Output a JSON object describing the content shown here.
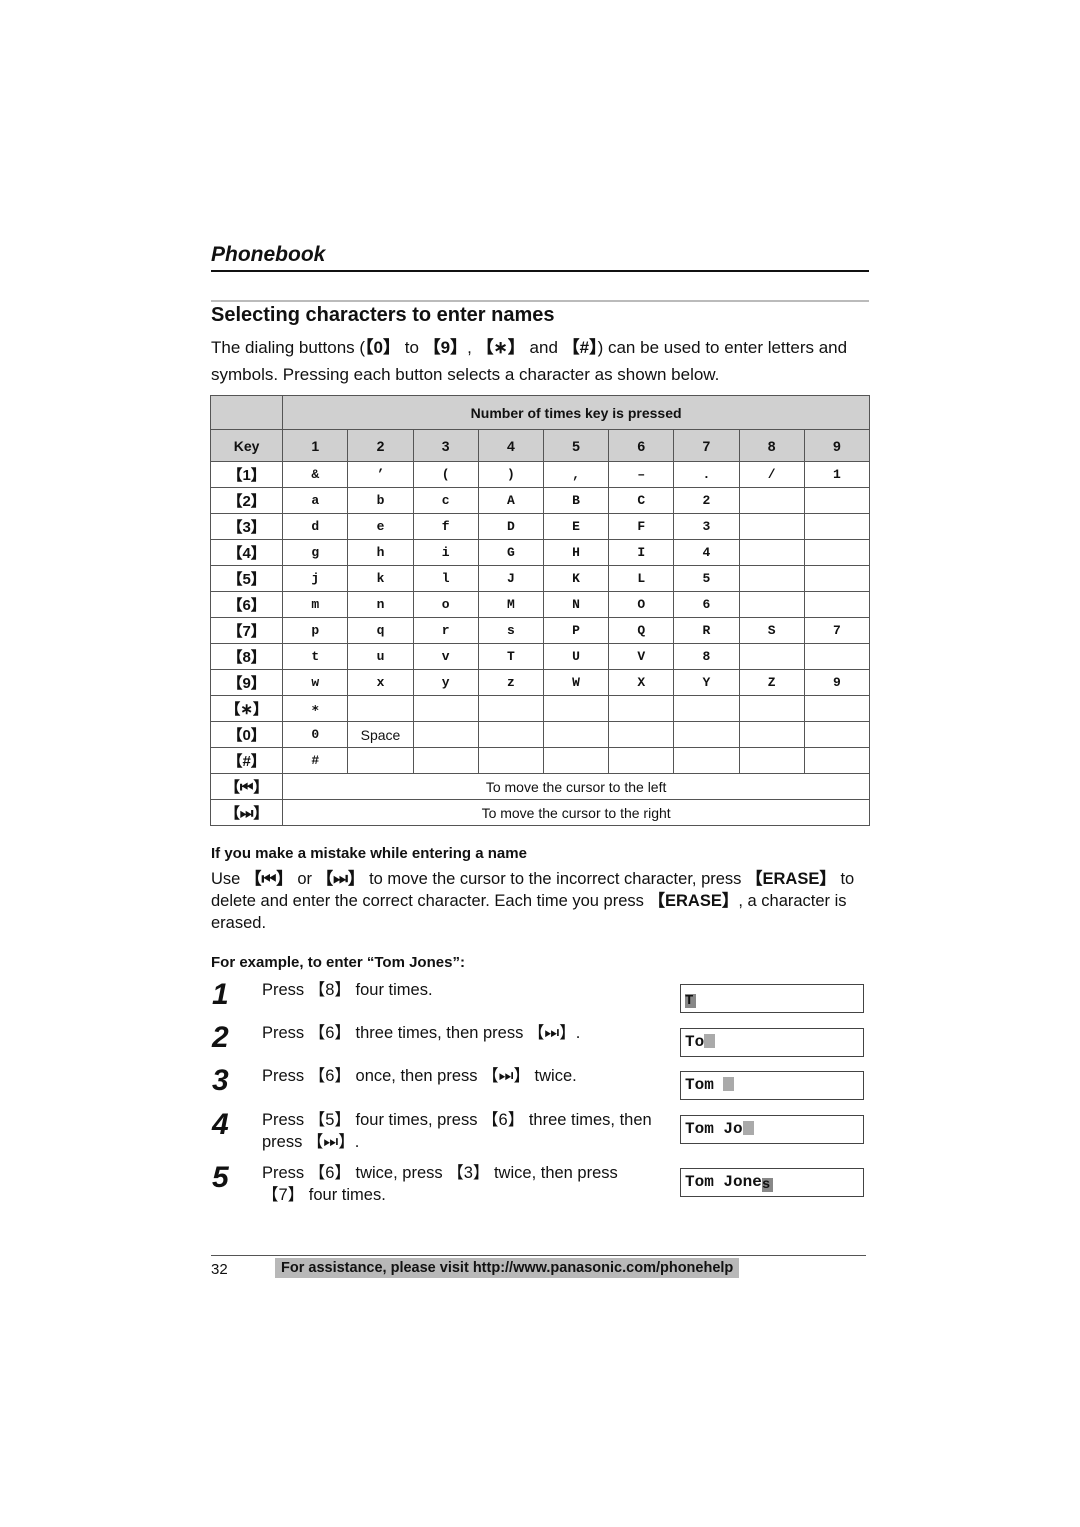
{
  "section": {
    "title": "Phonebook"
  },
  "heading": "Selecting characters to enter names",
  "intro": {
    "p1": "The dialing buttons (",
    "k0": "【0】",
    "p2": " to ",
    "k9": "【9】",
    "p3": ", ",
    "kstar": "【∗】",
    "p4": " and ",
    "khash": "【#】",
    "p5": ") can be used to enter letters and symbols. Pressing each button selects a character as shown below."
  },
  "table": {
    "group_header": "Number of times key is pressed",
    "key_header": "Key",
    "press_counts": [
      "1",
      "2",
      "3",
      "4",
      "5",
      "6",
      "7",
      "8",
      "9"
    ],
    "rows": [
      {
        "key": "【1】",
        "chars": [
          "&",
          "’",
          "(",
          ")",
          ",",
          "–",
          ".",
          "/",
          "1"
        ]
      },
      {
        "key": "【2】",
        "chars": [
          "a",
          "b",
          "c",
          "A",
          "B",
          "C",
          "2",
          "",
          ""
        ]
      },
      {
        "key": "【3】",
        "chars": [
          "d",
          "e",
          "f",
          "D",
          "E",
          "F",
          "3",
          "",
          ""
        ]
      },
      {
        "key": "【4】",
        "chars": [
          "g",
          "h",
          "i",
          "G",
          "H",
          "I",
          "4",
          "",
          ""
        ]
      },
      {
        "key": "【5】",
        "chars": [
          "j",
          "k",
          "l",
          "J",
          "K",
          "L",
          "5",
          "",
          ""
        ]
      },
      {
        "key": "【6】",
        "chars": [
          "m",
          "n",
          "o",
          "M",
          "N",
          "O",
          "6",
          "",
          ""
        ]
      },
      {
        "key": "【7】",
        "chars": [
          "p",
          "q",
          "r",
          "s",
          "P",
          "Q",
          "R",
          "S",
          "7"
        ]
      },
      {
        "key": "【8】",
        "chars": [
          "t",
          "u",
          "v",
          "T",
          "U",
          "V",
          "8",
          "",
          ""
        ]
      },
      {
        "key": "【9】",
        "chars": [
          "w",
          "x",
          "y",
          "z",
          "W",
          "X",
          "Y",
          "Z",
          "9"
        ]
      },
      {
        "key": "【∗】",
        "chars": [
          "∗",
          "",
          "",
          "",
          "",
          "",
          "",
          "",
          ""
        ]
      },
      {
        "key": "【0】",
        "chars": [
          "0",
          "Space",
          "",
          "",
          "",
          "",
          "",
          "",
          ""
        ]
      },
      {
        "key": "【#】",
        "chars": [
          "#",
          "",
          "",
          "",
          "",
          "",
          "",
          "",
          ""
        ]
      }
    ],
    "nav_rows": [
      {
        "key": "【⏮】",
        "icon": "skip-back-icon",
        "text": "To move the cursor to the left"
      },
      {
        "key": "【⏭】",
        "icon": "skip-forward-icon",
        "text": "To move the cursor to the right"
      }
    ]
  },
  "mistake": {
    "title": "If you make a mistake while entering a name",
    "p1": "Use ",
    "k_left": "【⏮】",
    "p2": " or ",
    "k_right": "【⏭】",
    "p3": " to move the cursor to the incorrect character, press ",
    "k_erase": "【ERASE】",
    "p4": " to delete and enter the correct character. Each time you press ",
    "k_erase2": "【ERASE】",
    "p5": ", a character is erased."
  },
  "example": {
    "title": "For example, to enter “Tom Jones”:",
    "steps": [
      {
        "num": "1",
        "text": "Press 【8】 four times.",
        "display": "T"
      },
      {
        "num": "2",
        "text": "Press 【6】 three times, then press 【⏭】.",
        "display": "To"
      },
      {
        "num": "3",
        "text": "Press 【6】 once, then press 【⏭】 twice.",
        "display": "Tom "
      },
      {
        "num": "4",
        "text": "Press 【5】 four times, press 【6】 three times, then press 【⏭】.",
        "display": "Tom Jo"
      },
      {
        "num": "5",
        "text": "Press 【6】 twice, press 【3】 twice, then press 【7】 four times.",
        "display": "Tom Jone"
      }
    ],
    "display_cursor_chars": [
      "T",
      "",
      "",
      "",
      "s"
    ]
  },
  "footer": {
    "page_number": "32",
    "help_text": "For assistance, please visit http://www.panasonic.com/phonehelp"
  }
}
